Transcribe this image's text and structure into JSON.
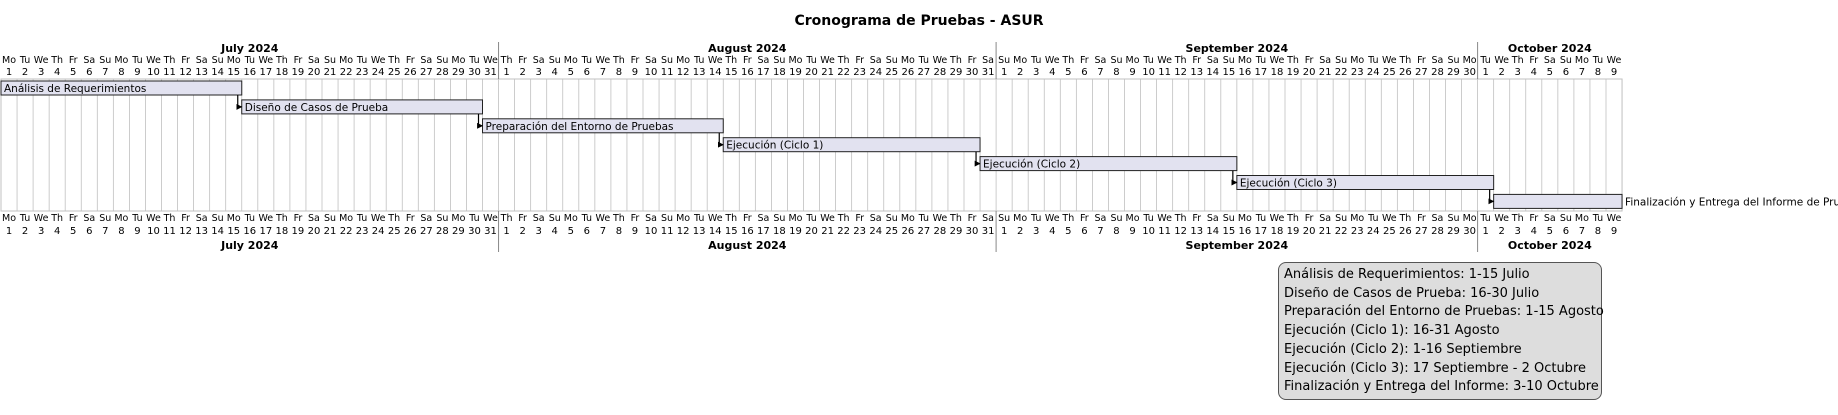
{
  "title": "Cronograma de Pruebas - ASUR",
  "chart_data": {
    "type": "gantt",
    "title": "Cronograma de Pruebas - ASUR",
    "start_date": "2024-07-01",
    "end_date": "2024-10-09",
    "months": [
      {
        "label": "July 2024",
        "start": "2024-07-01",
        "end": "2024-07-31"
      },
      {
        "label": "August 2024",
        "start": "2024-08-01",
        "end": "2024-08-31"
      },
      {
        "label": "September 2024",
        "start": "2024-09-01",
        "end": "2024-09-30"
      },
      {
        "label": "October 2024",
        "start": "2024-10-01",
        "end": "2024-10-09"
      }
    ],
    "weekday_labels": [
      "Mo",
      "Tu",
      "We",
      "Th",
      "Fr",
      "Sa",
      "Su"
    ],
    "tasks": [
      {
        "name": "Análisis de Requerimientos",
        "start": "2024-07-01",
        "end": "2024-07-15",
        "label_position": "inside"
      },
      {
        "name": "Diseño de Casos de Prueba",
        "start": "2024-07-16",
        "end": "2024-07-30",
        "label_position": "inside"
      },
      {
        "name": "Preparación del Entorno de Pruebas",
        "start": "2024-07-31",
        "end": "2024-08-14",
        "label_position": "inside"
      },
      {
        "name": "Ejecución (Ciclo 1)",
        "start": "2024-08-15",
        "end": "2024-08-30",
        "label_position": "inside"
      },
      {
        "name": "Ejecución (Ciclo 2)",
        "start": "2024-08-31",
        "end": "2024-09-15",
        "label_position": "inside"
      },
      {
        "name": "Ejecución (Ciclo 3)",
        "start": "2024-09-16",
        "end": "2024-10-01",
        "label_position": "inside"
      },
      {
        "name": "Finalización y Entrega del Informe de Pruebas",
        "start": "2024-10-02",
        "end": "2024-10-09",
        "label_position": "right"
      }
    ],
    "dependencies": [
      [
        0,
        1
      ],
      [
        1,
        2
      ],
      [
        2,
        3
      ],
      [
        3,
        4
      ],
      [
        4,
        5
      ],
      [
        5,
        6
      ]
    ],
    "colors": {
      "bar_fill": "#e2e2f0",
      "bar_stroke": "#222222",
      "grid": "#c0c0c0",
      "arrow": "#000000"
    }
  },
  "legend": {
    "lines": [
      "Análisis de Requerimientos: 1-15 Julio",
      "Diseño de Casos de Prueba: 16-30 Julio",
      "Preparación del Entorno de Pruebas: 1-15 Agosto",
      "Ejecución (Ciclo 1): 16-31 Agosto",
      "Ejecución (Ciclo 2): 1-16 Septiembre",
      "Ejecución (Ciclo 3): 17 Septiembre - 2 Octubre",
      "Finalización y Entrega del Informe: 3-10 Octubre"
    ]
  }
}
